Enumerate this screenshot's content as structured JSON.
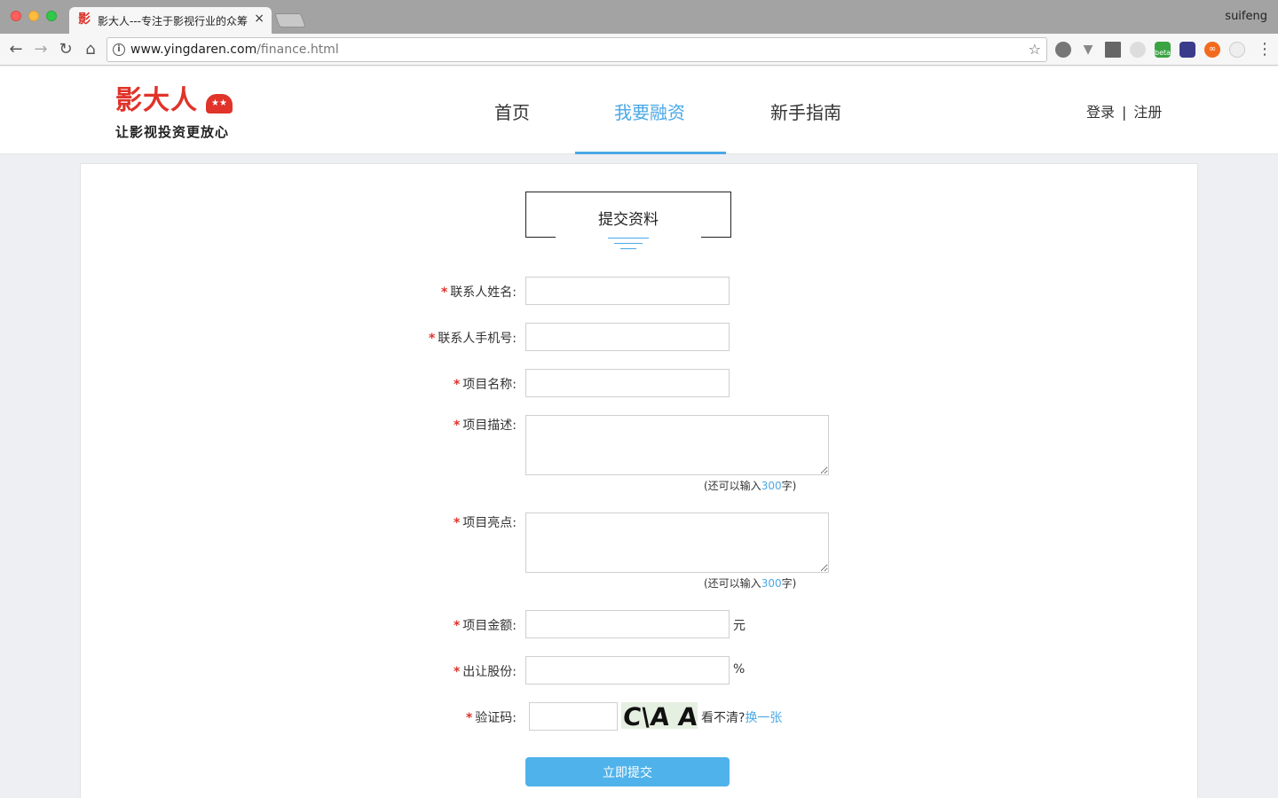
{
  "browser": {
    "tab_title": "影大人---专注于影视行业的众筹",
    "tab_close": "×",
    "profile_name": "suifeng",
    "url_domain": "www.yingdaren.com",
    "url_path": "/finance.html",
    "icons": [
      "back-arrow",
      "forward-arrow",
      "reload",
      "home",
      "info",
      "star",
      "menu-dots"
    ]
  },
  "header": {
    "logo_main": "影大人",
    "logo_badge": "★★",
    "logo_slogan": "让影视投资更放心",
    "nav": [
      {
        "label": "首页"
      },
      {
        "label": "我要融资"
      },
      {
        "label": "新手指南"
      }
    ],
    "login": "登录",
    "separator": "|",
    "register": "注册"
  },
  "form": {
    "section_title": "提交资料",
    "required_mark": "*",
    "fields": {
      "contact_name": {
        "label": "联系人姓名:",
        "value": ""
      },
      "contact_phone": {
        "label": "联系人手机号:",
        "value": ""
      },
      "project_name": {
        "label": "项目名称:",
        "value": ""
      },
      "project_desc": {
        "label": "项目描述:",
        "value": ""
      },
      "project_highlight": {
        "label": "项目亮点:",
        "value": ""
      },
      "project_amount": {
        "label": "项目金额:",
        "value": "",
        "unit": "元"
      },
      "equity_share": {
        "label": "出让股份:",
        "value": "",
        "unit": "%"
      },
      "captcha": {
        "label": "验证码:",
        "value": ""
      }
    },
    "remain_prefix": "(还可以输入",
    "remain_count": "300",
    "remain_suffix": "字)",
    "captcha_image_text": "C\\A A",
    "captcha_hint": "看不清?",
    "captcha_refresh": "换一张",
    "submit_label": "立即提交"
  }
}
